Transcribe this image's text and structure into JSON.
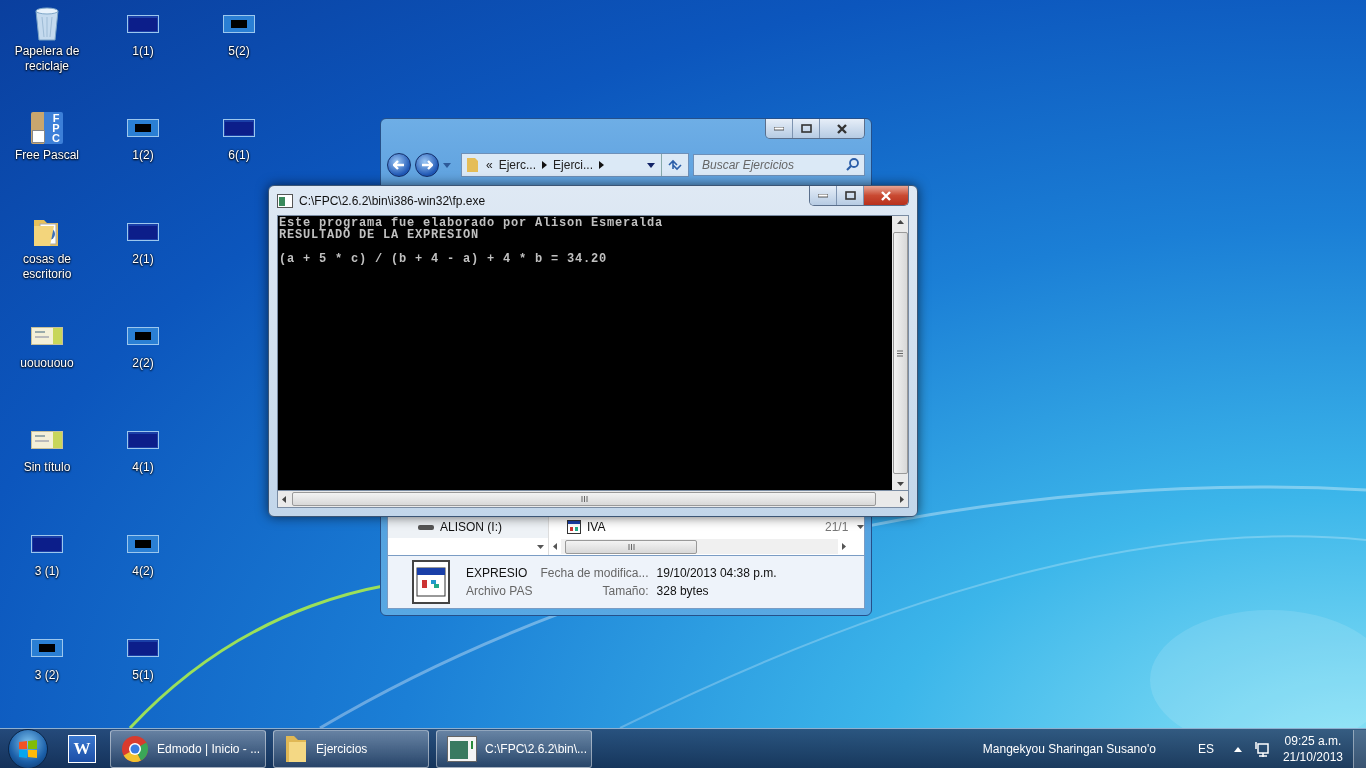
{
  "desktop": {
    "icon_columns": [
      [
        {
          "label": "Papelera de reciclaje",
          "kind": "bin"
        },
        {
          "label": "Free Pascal",
          "kind": "fpc",
          "logo": "FPC"
        },
        {
          "label": "cosas de escritorio",
          "kind": "folder"
        },
        {
          "label": "uouououo",
          "kind": "card"
        },
        {
          "label": "Sin título",
          "kind": "card"
        },
        {
          "label": "3 (1)",
          "kind": "screen-blue"
        },
        {
          "label": "3 (2)",
          "kind": "screen-black"
        }
      ],
      [
        {
          "label": "1(1)",
          "kind": "screen-blue"
        },
        {
          "label": "1(2)",
          "kind": "screen-black"
        },
        {
          "label": "2(1)",
          "kind": "screen-blue"
        },
        {
          "label": "2(2)",
          "kind": "screen-black"
        },
        {
          "label": "4(1)",
          "kind": "screen-blue"
        },
        {
          "label": "4(2)",
          "kind": "screen-black"
        },
        {
          "label": "5(1)",
          "kind": "screen-blue"
        }
      ],
      [
        {
          "label": "5(2)",
          "kind": "screen-black"
        },
        {
          "label": "6(1)",
          "kind": "screen-blue"
        }
      ]
    ]
  },
  "explorer": {
    "breadcrumb_overflow": "«",
    "breadcrumbs": [
      "Ejerc...",
      "Ejerci..."
    ],
    "search": {
      "placeholder": "Buscar Ejercicios"
    },
    "nav_items": [
      {
        "label": "ALISON (I:)"
      }
    ],
    "files": [
      {
        "name": "IVA",
        "date": "21/1"
      }
    ],
    "details": {
      "name": "EXPRESIO",
      "type": "Archivo PAS",
      "fields": [
        {
          "label": "Fecha de modifica...",
          "value": "19/10/2013 04:38 p.m."
        },
        {
          "label": "Tamaño:",
          "value": "328 bytes"
        }
      ]
    }
  },
  "console": {
    "title": "C:\\FPC\\2.6.2\\bin\\i386-win32\\fp.exe",
    "paragraphs": [
      [
        "Este programa fue elaborado por Alison Esmeralda",
        "RESULTADO DE LA EXPRESION"
      ],
      [
        "(a + 5 * c) / (b + 4 - a) + 4 * b = 34.20"
      ]
    ]
  },
  "taskbar": {
    "pinned": [
      {
        "kind": "word",
        "logo": "W"
      }
    ],
    "tasks": [
      {
        "label": "Edmodo | Inicio - ...",
        "kind": "browser"
      },
      {
        "label": "Ejercicios",
        "kind": "folder"
      },
      {
        "label": "C:\\FPC\\2.6.2\\bin\\...",
        "kind": "console"
      }
    ],
    "toolbar_label": "Mangekyou Sharingan Susano'o",
    "language": "ES",
    "clock": {
      "time": "09:25 a.m.",
      "date": "21/10/2013"
    }
  }
}
